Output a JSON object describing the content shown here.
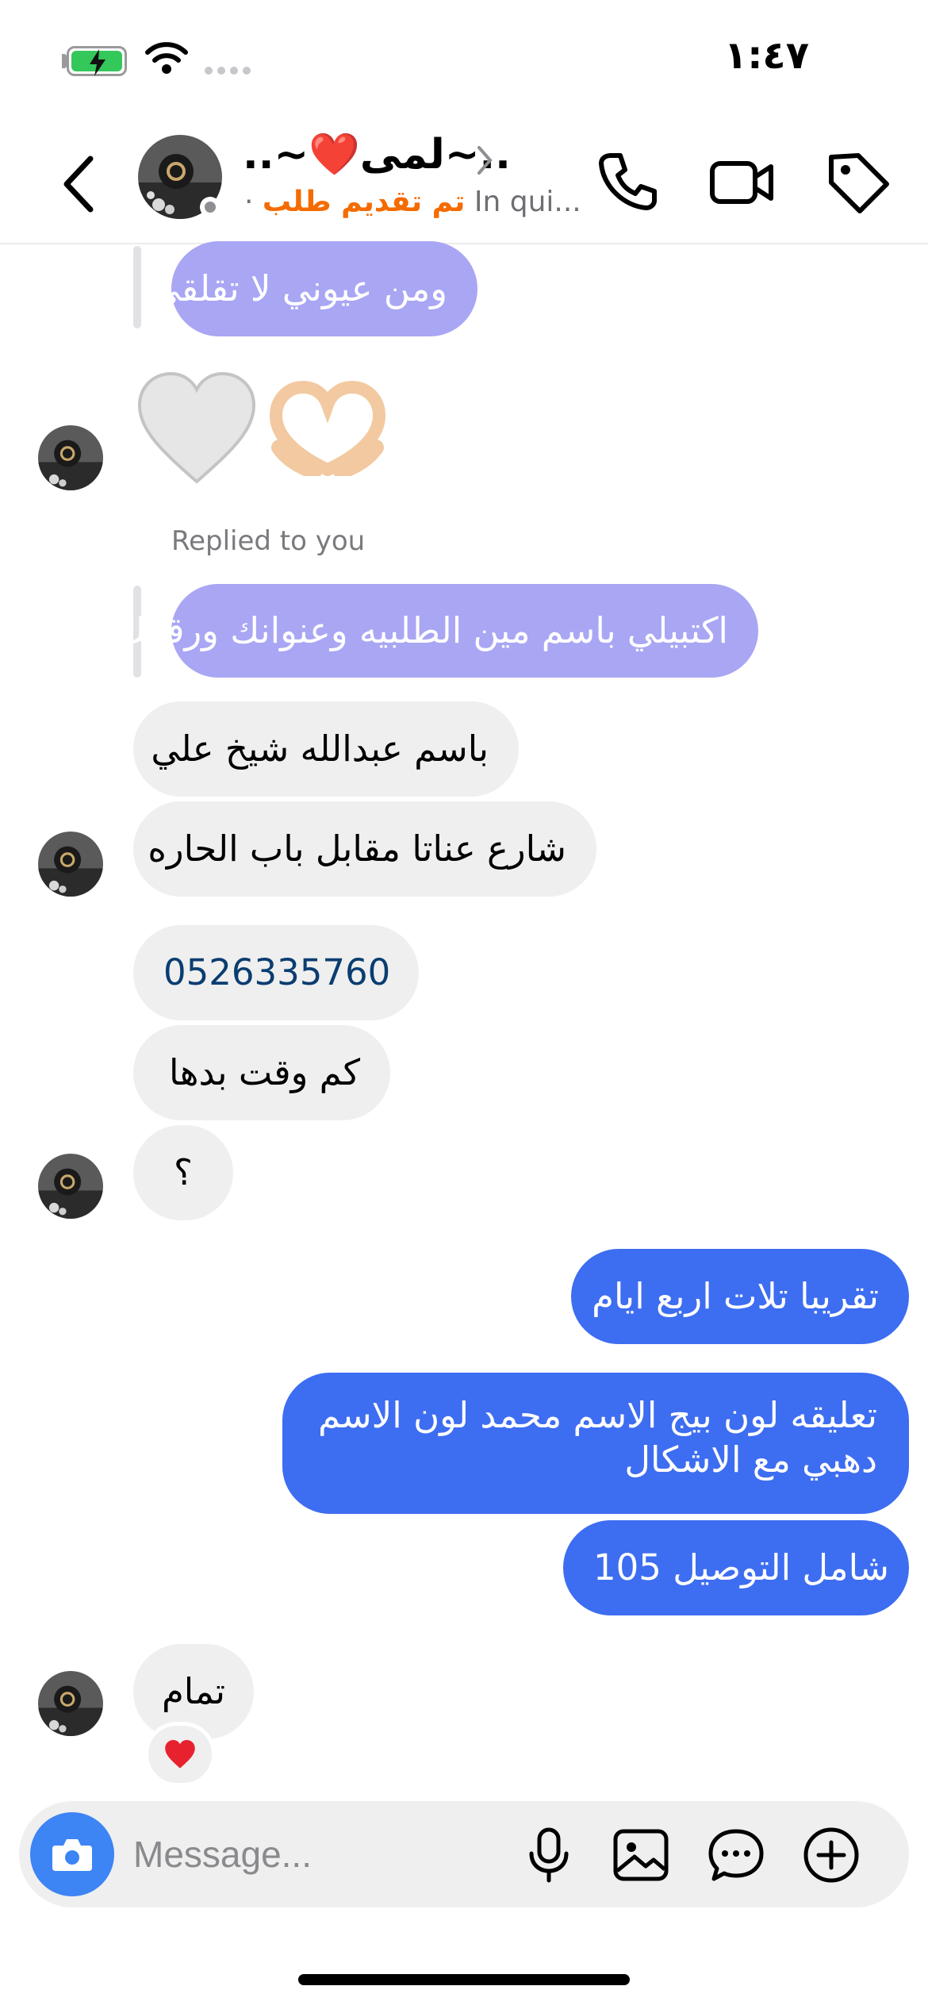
{
  "status_bar": {
    "time": "١:٤٧"
  },
  "header": {
    "contact_name": "..~لمى❤️~..",
    "subtitle_status": "تم تقديم طلب",
    "subtitle_folder": "In qui...",
    "subtitle_separator": "·"
  },
  "messages": {
    "quoted_1": "ومن عيوني لا تقلقي",
    "emoji_1": "🤍",
    "emoji_2": "🫶🏻",
    "replied_label": "Replied to you",
    "quoted_2": "اكتبيلي باسم مين الطلبيه وعنوانك ورقمك",
    "in_1": "باسم عبدالله شيخ علي",
    "in_2": "شارع عناتا مقابل باب الحاره",
    "in_3": "0526335760",
    "in_4": "كم وقت بدها",
    "in_5": "؟",
    "out_1": "تقريبا تلات اربع ايام",
    "out_2": "تعليقه لون بيج الاسم محمد لون الاسم دهبي مع الاشكال",
    "out_3": "105 شامل التوصيل",
    "in_6": "تمام",
    "reaction": "❤️"
  },
  "composer": {
    "placeholder": "Message..."
  },
  "colors": {
    "outgoing": "#3d6df1",
    "quoted": "#a9a6f4",
    "incoming": "#efefef",
    "accent_orange": "#f46b00",
    "camera": "#3d84f5"
  }
}
